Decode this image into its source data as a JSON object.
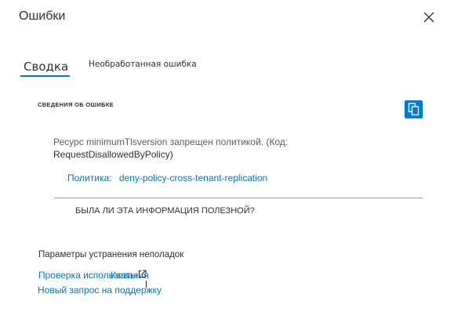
{
  "panel": {
    "title": "Ошибки"
  },
  "tabs": [
    {
      "label": "Сводка",
      "selected": true
    },
    {
      "label": "Необработанная ошибка",
      "selected": false
    }
  ],
  "details": {
    "section_label": "СВЕДЕНИЯ ОБ ОШИБКЕ",
    "message_line1": "Ресурс minimumTlsversion запрещен политикой. (Код:",
    "message_line2": "RequestDisallowedByPolicy)",
    "policy_label": "Политика:",
    "policy_link": "deny-policy-cross-tenant-replication",
    "helpful_question": "БЫЛА ЛИ ЭТА ИНФОРМАЦИЯ ПОЛЕЗНОЙ?"
  },
  "troubleshooting": {
    "heading": "Параметры устранения неполадок",
    "check_usage_link": "Проверка использования",
    "quota_link": "Квоты",
    "new_request_link": "Новый запрос на поддержку"
  },
  "colors": {
    "accent": "#0078d4",
    "text": "#323130",
    "muted": "#605e5c"
  },
  "icons": {
    "close": "close-icon",
    "copy": "copy-icon",
    "external": "external-link-icon"
  }
}
